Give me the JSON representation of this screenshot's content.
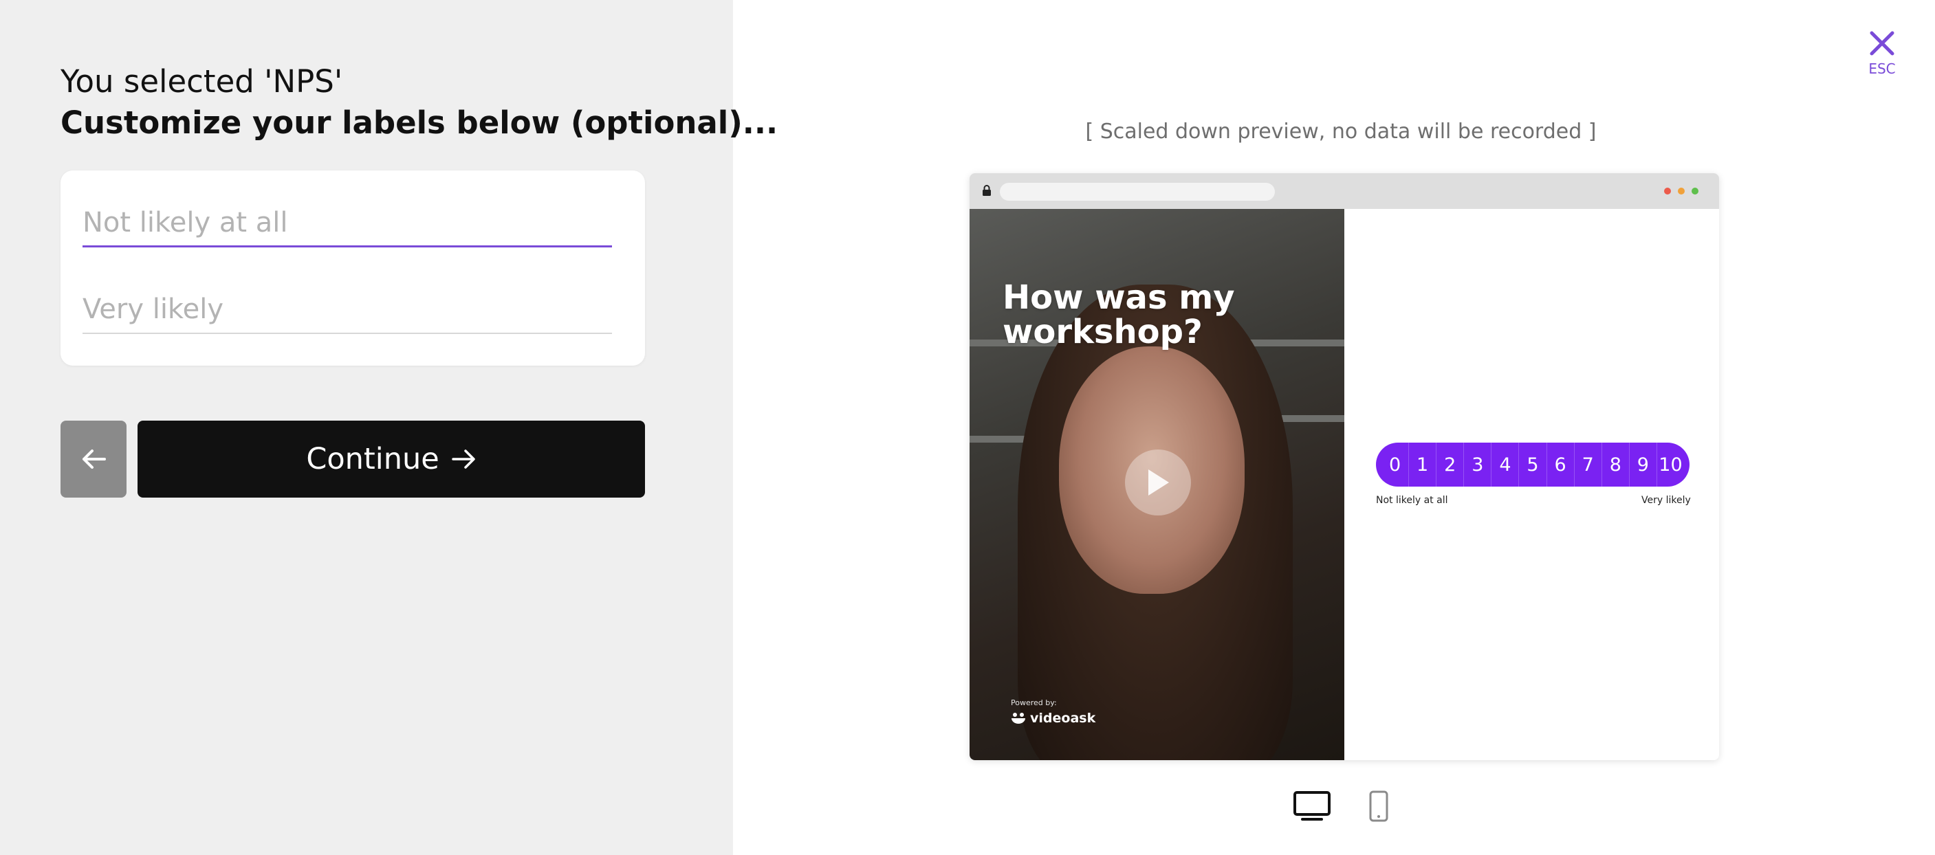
{
  "form": {
    "selection_text": "You selected 'NPS'",
    "instruction": "Customize your labels below (optional)...",
    "low_label_placeholder": "Not likely at all",
    "high_label_placeholder": "Very likely",
    "continue_label": "Continue"
  },
  "close": {
    "label": "ESC",
    "icon": "close-icon"
  },
  "preview": {
    "note": "[ Scaled down preview, no data will be recorded ]",
    "question": "How was my workshop?",
    "powered_by": "Powered by:",
    "brand": "videoask",
    "scale_values": [
      "0",
      "1",
      "2",
      "3",
      "4",
      "5",
      "6",
      "7",
      "8",
      "9",
      "10"
    ],
    "low_label": "Not likely at all",
    "high_label": "Very likely"
  },
  "device_toggle": {
    "desktop": "desktop-icon",
    "mobile": "mobile-icon",
    "selected": "desktop"
  },
  "colors": {
    "accent": "#7a22f2",
    "input_underline": "#7a4bd8",
    "left_pane_bg": "#efefef",
    "button_dark": "#111111"
  }
}
